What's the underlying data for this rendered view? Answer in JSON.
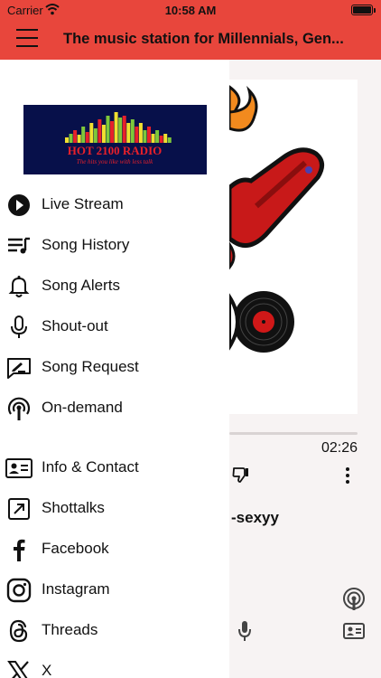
{
  "status_bar": {
    "carrier": "Carrier",
    "time": "10:58 AM"
  },
  "header": {
    "title": "The music station for Millennials, Gen..."
  },
  "logo": {
    "name": "HOT 2100 RADIO",
    "tagline": "The hits you like with less talk"
  },
  "menu": {
    "items": [
      {
        "label": "Live Stream",
        "icon": "play-circle-icon"
      },
      {
        "label": "Song History",
        "icon": "playlist-icon"
      },
      {
        "label": "Song Alerts",
        "icon": "bell-icon"
      },
      {
        "label": "Shout-out",
        "icon": "microphone-icon"
      },
      {
        "label": "Song Request",
        "icon": "request-icon"
      },
      {
        "label": "On-demand",
        "icon": "podcast-icon"
      },
      {
        "label": "Info & Contact",
        "icon": "contact-card-icon"
      },
      {
        "label": "Shottalks",
        "icon": "external-link-icon"
      },
      {
        "label": "Facebook",
        "icon": "facebook-icon"
      },
      {
        "label": "Instagram",
        "icon": "instagram-icon"
      },
      {
        "label": "Threads",
        "icon": "threads-icon"
      },
      {
        "label": "X",
        "icon": "x-icon"
      }
    ]
  },
  "player": {
    "duration": "02:26",
    "track_title": "-sexyy",
    "progress": 0.0
  },
  "colors": {
    "header": "#e8463c",
    "drawer_bg": "#ffffff",
    "player_bg": "#f7f3f3"
  }
}
